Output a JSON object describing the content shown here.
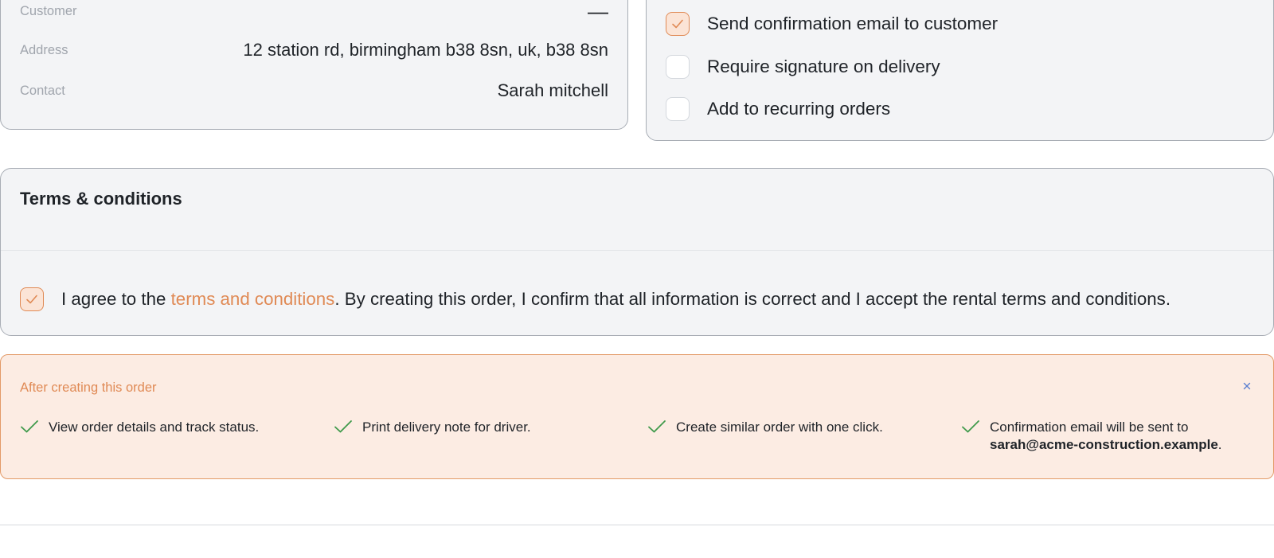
{
  "summary": {
    "customer_label": "Customer",
    "customer_value": "—",
    "address_label": "Address",
    "address_value": "12 station rd, birmingham b38 8sn, uk, b38 8sn",
    "contact_label": "Contact",
    "contact_value": "Sarah mitchell"
  },
  "options": {
    "items": [
      {
        "label": "Send confirmation email to customer",
        "checked": true
      },
      {
        "label": "Require signature on delivery",
        "checked": false
      },
      {
        "label": "Add to recurring orders",
        "checked": false
      }
    ]
  },
  "terms": {
    "title": "Terms & conditions",
    "agree_prefix": "I agree to the ",
    "agree_link": "terms and conditions",
    "agree_suffix": ". By creating this order, I confirm that all information is correct and I accept the rental terms and conditions.",
    "checked": true
  },
  "after": {
    "title": "After creating this order",
    "close_icon": "close-icon",
    "steps": [
      {
        "text": "View order details and track status."
      },
      {
        "text": "Print delivery note for driver."
      },
      {
        "text": "Create similar order with one click."
      },
      {
        "text": "Confirmation email will be sent to",
        "email": "sarah@acme-construction.example",
        "end": "."
      }
    ]
  },
  "colors": {
    "accent": "#e08a55",
    "success": "#3f9a4b",
    "info_close": "#5b7fd1",
    "card_bg": "#f3f4f6",
    "notice_bg": "#fcece3"
  }
}
